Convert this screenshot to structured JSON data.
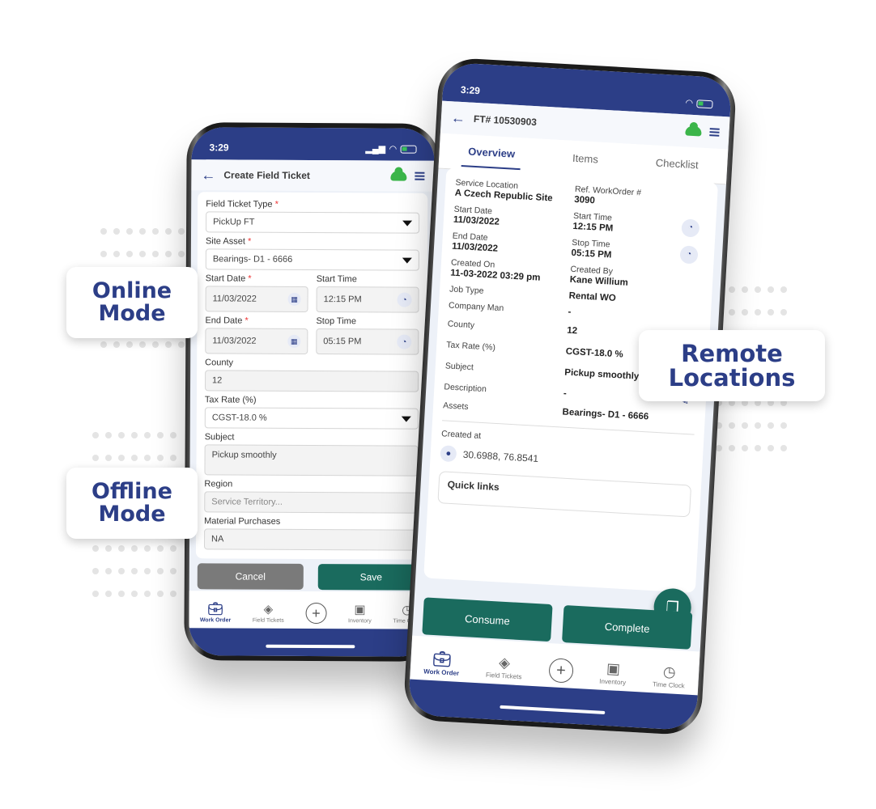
{
  "callouts": {
    "online": [
      "Online",
      "Mode"
    ],
    "offline": [
      "Offline",
      "Mode"
    ],
    "remote": [
      "Remote",
      "Locations"
    ]
  },
  "colors": {
    "brand_navy": "#2c3e87",
    "action_green": "#1a6b5e",
    "cloud_green": "#3bb54a",
    "cancel_grey": "#7a7a7a"
  },
  "left_phone": {
    "status_time": "3:29",
    "title": "Create Field Ticket",
    "icons": {
      "back": "arrow-left-icon",
      "sync": "cloud-icon",
      "menu": "hamburger-icon"
    },
    "form": {
      "field_ticket_type": {
        "label": "Field Ticket Type",
        "required": "*",
        "value": "PickUp FT"
      },
      "site_asset": {
        "label": "Site Asset",
        "required": "*",
        "value": "Bearings- D1 - 6666"
      },
      "start_date": {
        "label": "Start Date",
        "required": "*",
        "value": "11/03/2022"
      },
      "start_time": {
        "label": "Start Time",
        "value": "12:15 PM"
      },
      "end_date": {
        "label": "End Date",
        "required": "*",
        "value": "11/03/2022"
      },
      "stop_time": {
        "label": "Stop Time",
        "value": "05:15 PM"
      },
      "county": {
        "label": "County",
        "value": "12"
      },
      "tax_rate": {
        "label": "Tax Rate (%)",
        "value": "CGST-18.0 %"
      },
      "subject": {
        "label": "Subject",
        "value": "Pickup smoothly"
      },
      "region": {
        "label": "Region",
        "placeholder": "Service Territory..."
      },
      "material_purchases": {
        "label": "Material Purchases",
        "value": "NA"
      }
    },
    "buttons": {
      "cancel": "Cancel",
      "save": "Save"
    },
    "nav": [
      {
        "label": "Work Order",
        "icon": "briefcase-icon",
        "active": true
      },
      {
        "label": "Field Tickets",
        "icon": "ticket-icon"
      },
      {
        "label": "",
        "icon": "plus-circle-icon"
      },
      {
        "label": "Inventory",
        "icon": "cart-icon"
      },
      {
        "label": "Time Clock",
        "icon": "clock-icon"
      }
    ]
  },
  "right_phone": {
    "status_time": "3:29",
    "title": "FT# 10530903",
    "tabs": [
      "Overview",
      "Items",
      "Checklist"
    ],
    "active_tab": "Overview",
    "overview": {
      "service_location": {
        "label": "Service Location",
        "value": "A Czech Republic Site"
      },
      "ref_workorder": {
        "label": "Ref. WorkOrder #",
        "value": "3090"
      },
      "start_date": {
        "label": "Start Date",
        "value": "11/03/2022"
      },
      "start_time": {
        "label": "Start Time",
        "value": "12:15 PM"
      },
      "end_date": {
        "label": "End Date",
        "value": "11/03/2022"
      },
      "stop_time": {
        "label": "Stop Time",
        "value": "05:15 PM"
      },
      "created_on": {
        "label": "Created On",
        "value": "11-03-2022 03:29 pm"
      },
      "created_by": {
        "label": "Created By",
        "value": "Kane Willium"
      },
      "rows": [
        {
          "label": "Job Type",
          "value": "Rental WO",
          "editable": false
        },
        {
          "label": "Company Man",
          "value": "-",
          "editable": false
        },
        {
          "label": "County",
          "value": "12",
          "editable": true
        },
        {
          "label": "Tax Rate (%)",
          "value": "CGST-18.0 %",
          "editable": true
        },
        {
          "label": "Subject",
          "value": "Pickup smoothly",
          "editable": true
        },
        {
          "label": "Description",
          "value": "-",
          "editable": true
        },
        {
          "label": "Assets",
          "value": "Bearings- D1 - 6666",
          "editable": false
        }
      ],
      "created_at_label": "Created at",
      "coordinates": "30.6988, 76.8541",
      "quick_links": "Quick links"
    },
    "buttons": {
      "consume": "Consume",
      "complete": "Complete"
    },
    "nav": [
      {
        "label": "Work Order",
        "icon": "briefcase-icon",
        "active": true
      },
      {
        "label": "Field Tickets",
        "icon": "ticket-icon"
      },
      {
        "label": "",
        "icon": "plus-circle-icon"
      },
      {
        "label": "Inventory",
        "icon": "cart-icon"
      },
      {
        "label": "Time Clock",
        "icon": "clock-icon"
      }
    ]
  }
}
